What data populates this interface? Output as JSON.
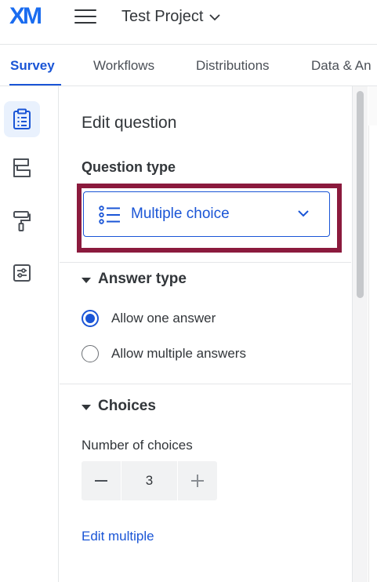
{
  "header": {
    "logo": "XM",
    "project_name": "Test Project"
  },
  "nav_tabs": [
    {
      "label": "Survey",
      "active": true
    },
    {
      "label": "Workflows",
      "active": false
    },
    {
      "label": "Distributions",
      "active": false
    },
    {
      "label": "Data & An",
      "active": false
    }
  ],
  "rail": [
    {
      "icon": "clipboard-icon",
      "active": true
    },
    {
      "icon": "blocks-icon",
      "active": false
    },
    {
      "icon": "paint-roller-icon",
      "active": false
    },
    {
      "icon": "settings-sliders-icon",
      "active": false
    }
  ],
  "panel": {
    "title": "Edit question",
    "question_type_label": "Question type",
    "question_type_value": "Multiple choice",
    "answer_type": {
      "heading": "Answer type",
      "options": [
        {
          "label": "Allow one answer",
          "checked": true
        },
        {
          "label": "Allow multiple answers",
          "checked": false
        }
      ]
    },
    "choices": {
      "heading": "Choices",
      "number_label": "Number of choices",
      "number_value": "3",
      "edit_multiple": "Edit multiple"
    }
  },
  "colors": {
    "accent": "#1a55d6",
    "highlight_border": "#8b1a3d",
    "logo": "#1a6cf0"
  }
}
